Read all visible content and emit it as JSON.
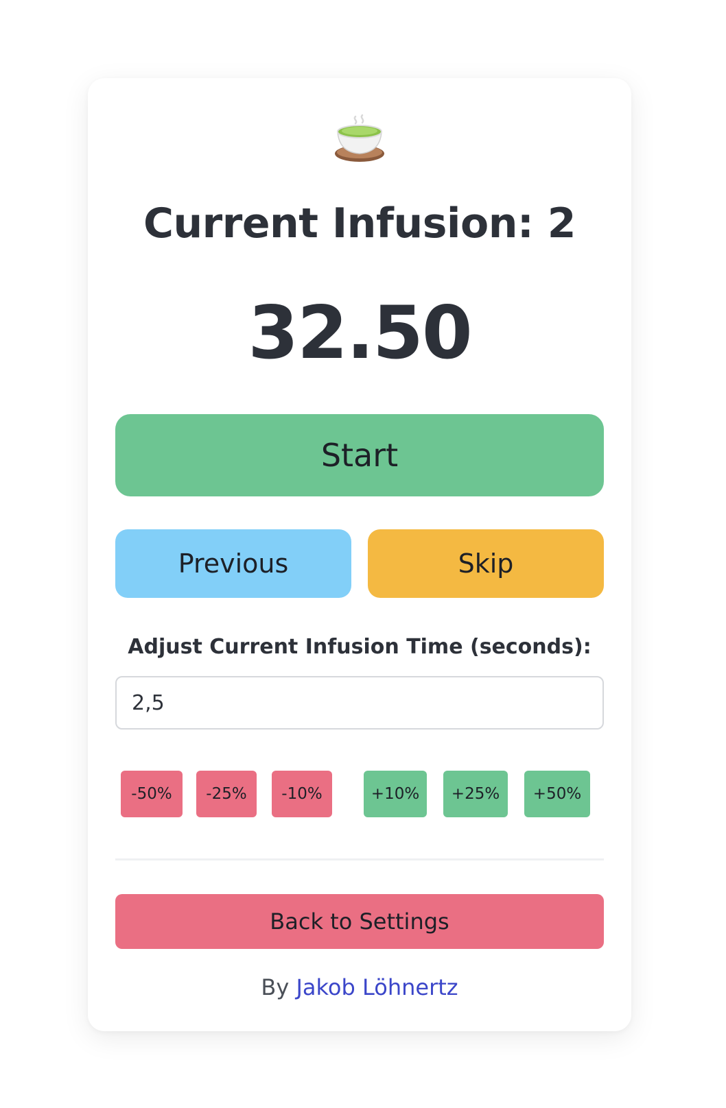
{
  "app": {
    "icon": "teacup-icon"
  },
  "infusion": {
    "title": "Current Infusion: 2",
    "timer": "32.50"
  },
  "buttons": {
    "start": "Start",
    "previous": "Previous",
    "skip": "Skip",
    "back": "Back to Settings"
  },
  "adjust": {
    "label": "Adjust Current Infusion Time (seconds):",
    "value": "2,5",
    "decrease": [
      "-50%",
      "-25%",
      "-10%"
    ],
    "increase": [
      "+10%",
      "+25%",
      "+50%"
    ]
  },
  "footer": {
    "by": "By",
    "author": "Jakob Löhnertz"
  },
  "colors": {
    "start": "#6dc592",
    "previous": "#82cff8",
    "skip": "#f4b942",
    "decrease": "#ea6f83",
    "increase": "#6dc592",
    "back": "#ea6f83",
    "link": "#3b46c9"
  }
}
